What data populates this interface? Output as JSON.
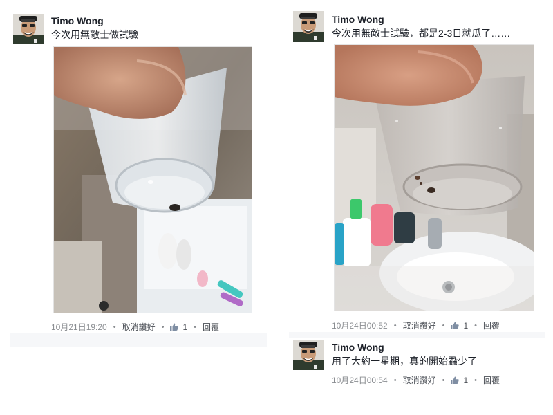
{
  "left": {
    "post": {
      "author": "Timo Wong",
      "text": "今次用無敵士做試驗",
      "meta": {
        "time": "10月21日19:20",
        "unlike": "取消讚好",
        "likes": "1",
        "reply": "回覆"
      }
    }
  },
  "right": {
    "post": {
      "author": "Timo Wong",
      "text": "今次用無敵士試驗，都是2-3日就瓜了……",
      "meta": {
        "time": "10月24日00:52",
        "unlike": "取消讚好",
        "likes": "1",
        "reply": "回覆"
      }
    },
    "comment": {
      "author": "Timo Wong",
      "text": "用了大約一星期，真的開始蝨少了",
      "meta": {
        "time": "10月24日00:54",
        "unlike": "取消讚好",
        "likes": "1",
        "reply": "回覆"
      }
    }
  },
  "colors": {
    "meta_text": "#8a8d91",
    "link_text": "#4b4f56",
    "body_text": "#1d2129"
  },
  "icons": [
    "avatar",
    "thumbs-up-icon"
  ]
}
